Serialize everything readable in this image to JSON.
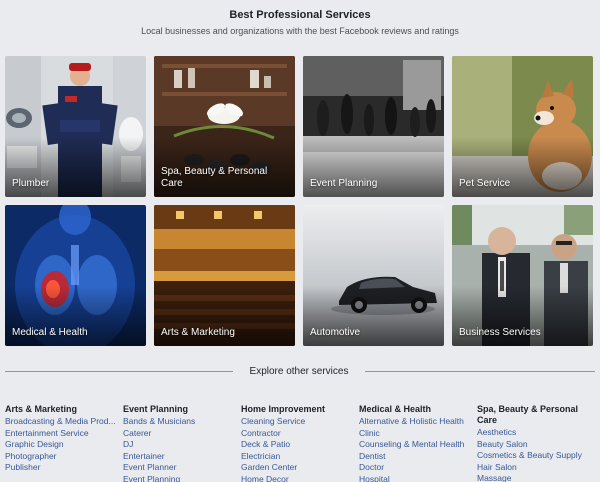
{
  "header": {
    "title": "Best Professional Services",
    "subtitle": "Local businesses and organizations with the best Facebook reviews and ratings"
  },
  "tiles": [
    {
      "label": "Plumber"
    },
    {
      "label": "Spa, Beauty & Personal Care"
    },
    {
      "label": "Event Planning"
    },
    {
      "label": "Pet Service"
    },
    {
      "label": "Medical & Health"
    },
    {
      "label": "Arts & Marketing"
    },
    {
      "label": "Automotive"
    },
    {
      "label": "Business Services"
    }
  ],
  "explore": {
    "label": "Explore other services"
  },
  "columns": [
    {
      "heading": "Arts & Marketing",
      "items": [
        "Broadcasting & Media Prod...",
        "Entertainment Service",
        "Graphic Design",
        "Photographer",
        "Publisher"
      ]
    },
    {
      "heading": "Event Planning",
      "items": [
        "Bands & Musicians",
        "Caterer",
        "DJ",
        "Entertainer",
        "Event Planner",
        "Event Planning"
      ]
    },
    {
      "heading": "Home Improvement",
      "items": [
        "Cleaning Service",
        "Contractor",
        "Deck & Patio",
        "Electrician",
        "Garden Center",
        "Home Decor"
      ]
    },
    {
      "heading": "Medical & Health",
      "items": [
        "Alternative & Holistic Health",
        "Clinic",
        "Counseling & Mental Health",
        "Dentist",
        "Doctor",
        "Hospital"
      ]
    },
    {
      "heading": "Spa, Beauty & Personal Care",
      "items": [
        "Aesthetics",
        "Beauty Salon",
        "Cosmetics & Beauty Supply",
        "Hair Salon",
        "Massage"
      ]
    }
  ]
}
